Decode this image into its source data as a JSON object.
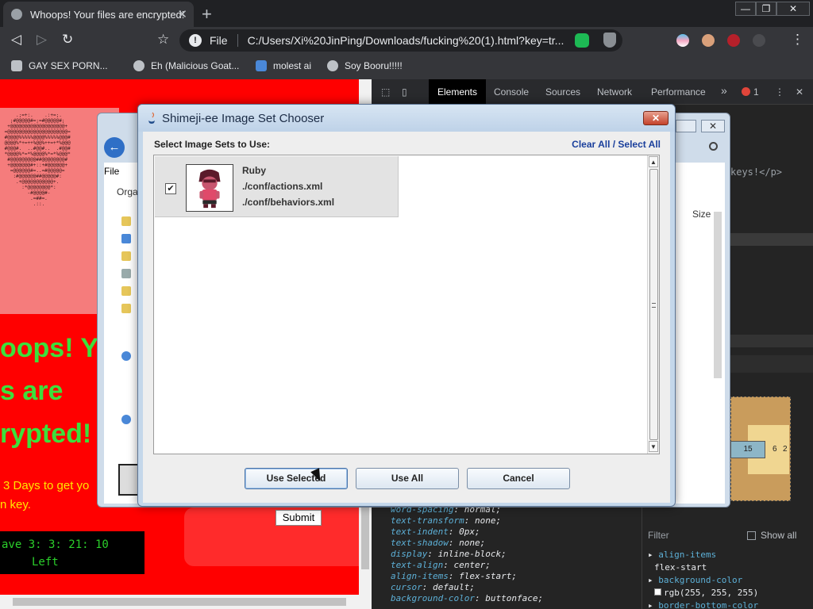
{
  "browser": {
    "tab_title": "Whoops! Your files are encrypted!",
    "tab_close": "✕",
    "new_tab": "+",
    "back": "◁",
    "forward": "▷",
    "reload": "↻",
    "bookmark_star": "☆",
    "info": "!",
    "scheme_label": "File",
    "url": "C:/Users/Xi%20JinPing/Downloads/fucking%20(1).html?key=tr...",
    "menu": "⋮",
    "window_min": "—",
    "window_max": "❐",
    "window_close": "✕",
    "bookmarks": [
      "GAY SEX PORN...",
      "Eh (Malicious Goat...",
      "molest ai",
      "Soy Booru!!!!!"
    ]
  },
  "page": {
    "headline_1": "oops! Yo",
    "headline_2": "s are",
    "headline_3": "rypted!",
    "days_text": "3 Days to get yo",
    "key_text": "n key.",
    "timer_line_1": "ave 3: 3: 21: 10",
    "timer_line_2": "Left",
    "submit_label": "Submit"
  },
  "devtools": {
    "tabs": [
      "Elements",
      "Console",
      "Sources",
      "Network",
      "Performance"
    ],
    "more": "»",
    "error_count": "1",
    "dom_fragment": "keys!</p>",
    "css_lines": [
      {
        "prop": "word-spacing",
        "value": "normal;"
      },
      {
        "prop": "text-transform",
        "value": "none;"
      },
      {
        "prop": "text-indent",
        "value": "0px;"
      },
      {
        "prop": "text-shadow",
        "value": "none;"
      },
      {
        "prop": "display",
        "value": "inline-block;"
      },
      {
        "prop": "text-align",
        "value": "center;"
      },
      {
        "prop": "align-items",
        "value": "flex-start;"
      },
      {
        "prop": "cursor",
        "value": "default;"
      },
      {
        "prop": "background-color",
        "value": "buttonface;"
      }
    ],
    "filter_label": "Filter",
    "show_all_label": "Show all",
    "computed": [
      {
        "prop": "align-items",
        "value": "flex-start"
      },
      {
        "prop": "background-color",
        "value": "rgb(255, 255, 255)"
      },
      {
        "prop": "border-bottom-color",
        "value": ""
      }
    ],
    "box_model": {
      "left": "15",
      "mid": "6",
      "right": "2"
    }
  },
  "explorer": {
    "file_menu": "File",
    "organize": "Orga",
    "size_header": "Size",
    "close": "✕"
  },
  "dialog": {
    "title": "Shimeji-ee Image Set Chooser",
    "close_label": "✕",
    "prompt": "Select Image Sets to Use:",
    "clear_all": "Clear All",
    "separator": " / ",
    "select_all": "Select All",
    "item": {
      "checked_mark": "✔",
      "name": "Ruby",
      "actions": "./conf/actions.xml",
      "behaviors": "./conf/behaviors.xml"
    },
    "buttons": {
      "use_selected": "Use Selected",
      "use_all": "Use All",
      "cancel": "Cancel"
    },
    "scroll_up": "▲",
    "scroll_down": "▼"
  }
}
